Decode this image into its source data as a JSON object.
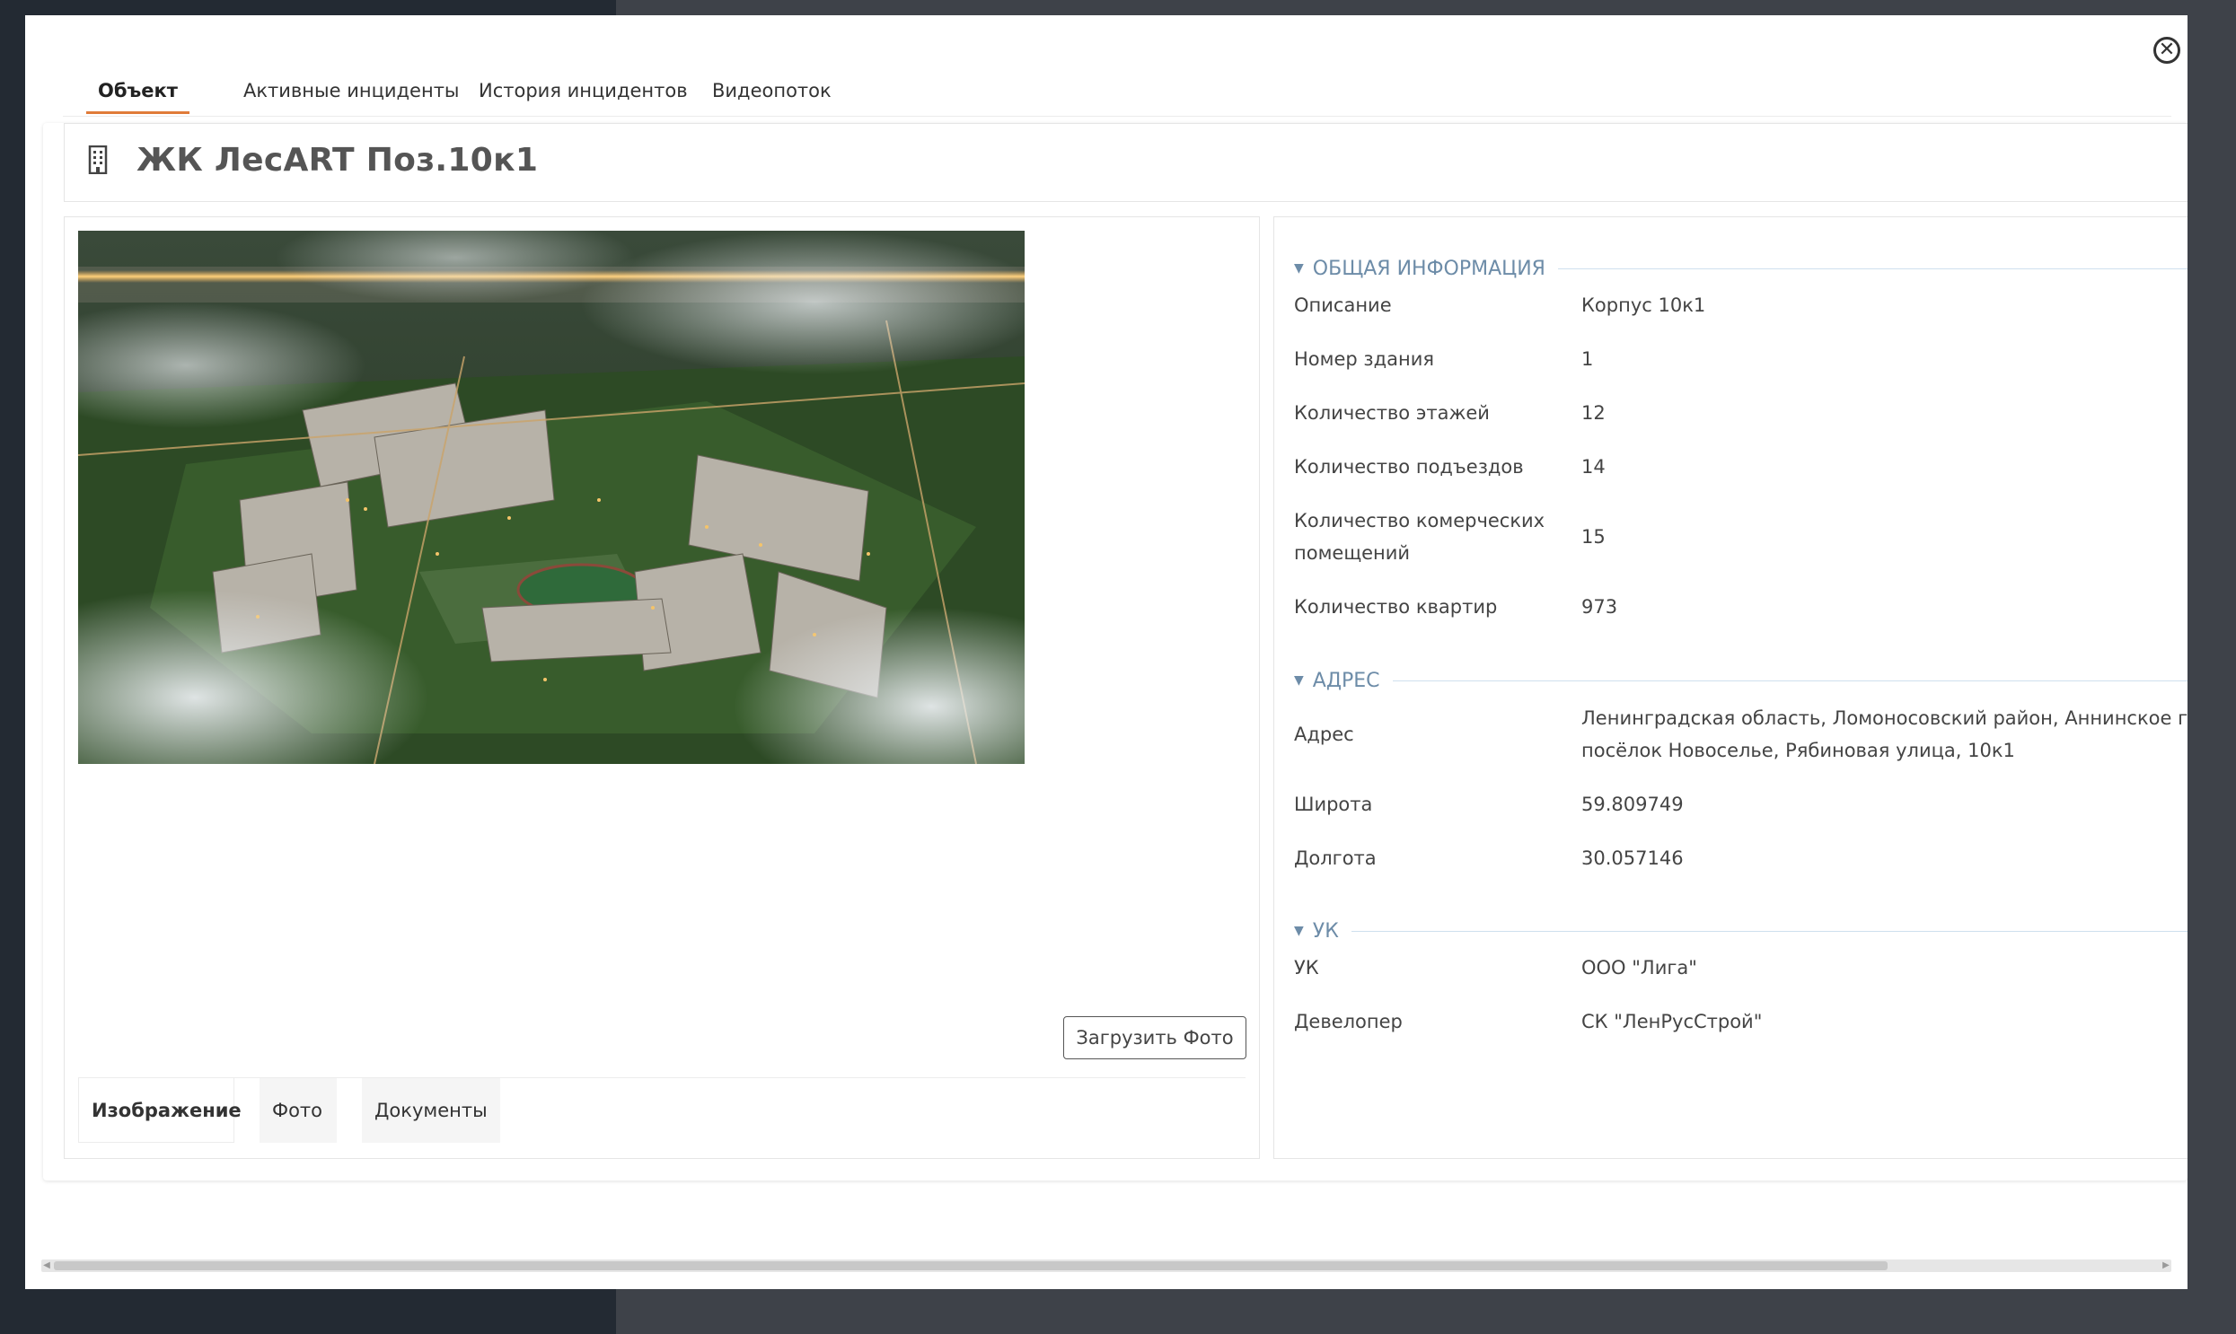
{
  "tabs": [
    "Объект",
    "Активные инциденты",
    "История инцидентов",
    "Видеопоток"
  ],
  "title": "ЖК ЛесART Поз.10к1",
  "upload_label": "Загрузить Фото",
  "bottom_tabs": [
    "Изображение",
    "Фото",
    "Документы"
  ],
  "sections": {
    "general": {
      "heading": "ОБЩАЯ ИНФОРМАЦИЯ",
      "rows": [
        {
          "label": "Описание",
          "value": "Корпус 10к1"
        },
        {
          "label": "Номер здания",
          "value": "1"
        },
        {
          "label": "Количество этажей",
          "value": "12"
        },
        {
          "label": "Количество подъездов",
          "value": "14"
        },
        {
          "label": "Количество комерческих помещений",
          "value": "15"
        },
        {
          "label": "Количество квартир",
          "value": "973"
        }
      ]
    },
    "address": {
      "heading": "АДРЕС",
      "rows": [
        {
          "label": "Адрес",
          "value_line1": "Ленинградская область, Ломоносовский район, Аннинское городское поселение,",
          "value_line2": "посёлок Новоселье, Рябиновая улица, 10к1"
        },
        {
          "label": "Широта",
          "value": "59.809749"
        },
        {
          "label": "Долгота",
          "value": "30.057146"
        }
      ]
    },
    "uk": {
      "heading": "УК",
      "rows": [
        {
          "label": "УК",
          "value": "ООО \"Лига\""
        },
        {
          "label": "Девелопер",
          "value": "СК \"ЛенРусСтрой\""
        }
      ]
    }
  },
  "icons": {
    "close": "close-circle-icon",
    "building": "building-icon",
    "collapse": "caret-down-icon"
  },
  "colors": {
    "accent": "#e07b39",
    "section": "#6d8ca8"
  }
}
